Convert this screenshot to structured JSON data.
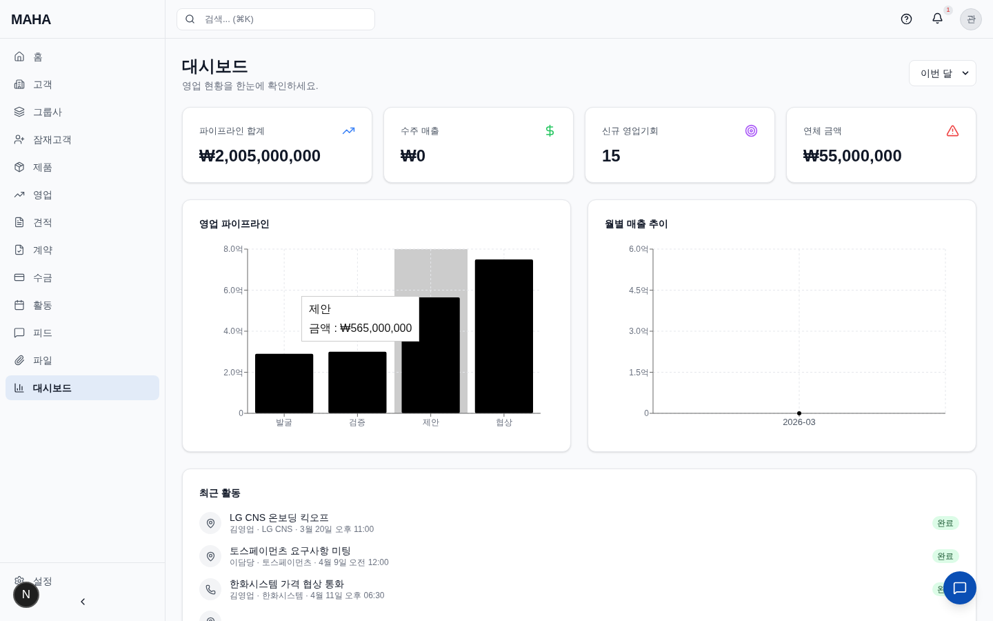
{
  "sidebar": {
    "logo": "MAHA",
    "items": [
      {
        "label": "홈",
        "selected": false
      },
      {
        "label": "고객",
        "selected": false
      },
      {
        "label": "그룹사",
        "selected": false
      },
      {
        "label": "잠재고객",
        "selected": false
      },
      {
        "label": "제품",
        "selected": false
      },
      {
        "label": "영업",
        "selected": false
      },
      {
        "label": "견적",
        "selected": false
      },
      {
        "label": "계약",
        "selected": false
      },
      {
        "label": "수금",
        "selected": false
      },
      {
        "label": "활동",
        "selected": false
      },
      {
        "label": "피드",
        "selected": false
      },
      {
        "label": "파일",
        "selected": false
      },
      {
        "label": "대시보드",
        "selected": true
      }
    ],
    "settings": "설정"
  },
  "dev_badge": "N",
  "header": {
    "search": {
      "placeholder": "검색... (⌘K)"
    },
    "notification_count": "1",
    "avatar": "관"
  },
  "page": {
    "title": "대시보드",
    "subtitle": "영업 현황을 한눈에 확인하세요.",
    "period": "이번 달"
  },
  "stats": [
    {
      "label": "파이프라인 합계",
      "value": "₩2,005,000,000",
      "kind": "trend",
      "color": "#3b82f6"
    },
    {
      "label": "수주 매출",
      "value": "₩0",
      "kind": "dollar",
      "color": "#22c55e"
    },
    {
      "label": "신규 영업기회",
      "value": "15",
      "kind": "target",
      "color": "#a855f7"
    },
    {
      "label": "연체 금액",
      "value": "₩55,000,000",
      "kind": "alert",
      "color": "#ef4444"
    }
  ],
  "pipeline": {
    "title": "영업 파이프라인",
    "highlight": [
      false,
      false,
      true,
      false
    ],
    "tooltip": {
      "title": "제안",
      "text": "금액 : ₩565,000,000"
    },
    "chart_data": {
      "type": "bar",
      "grid": true,
      "categories": [
        "발굴",
        "검증",
        "제안",
        "협상"
      ],
      "series": [
        {
          "color": "#000000",
          "values": [
            2.9,
            3.0,
            5.65,
            7.5
          ]
        }
      ],
      "ylim": [
        0,
        8
      ],
      "yticks": [
        {
          "value": 0,
          "label": "0"
        },
        {
          "value": 2,
          "label": "2.0억"
        },
        {
          "value": 4,
          "label": "4.0억"
        },
        {
          "value": 6,
          "label": "6.0억"
        },
        {
          "value": 8,
          "label": "8.0억"
        }
      ]
    }
  },
  "monthly": {
    "title": "월별 매출 추이",
    "chart_data": {
      "type": "line",
      "grid": true,
      "categories": [
        "2026-03"
      ],
      "series": [
        {
          "color": "#000000",
          "marker": true,
          "values": [
            0
          ]
        }
      ],
      "ylim": [
        0,
        6
      ],
      "yticks": [
        {
          "value": 0,
          "label": "0"
        },
        {
          "value": 1.5,
          "label": "1.5억"
        },
        {
          "value": 3,
          "label": "3.0억"
        },
        {
          "value": 4.5,
          "label": "4.5억"
        },
        {
          "value": 6,
          "label": "6.0억"
        }
      ]
    }
  },
  "activities": {
    "title": "최근 활동",
    "items": [
      {
        "kind": "visit",
        "title": "LG CNS 온보딩 킥오프",
        "meta": "김영업 · LG CNS · 3월 20일 오후 11:00",
        "status": "완료"
      },
      {
        "kind": "visit",
        "title": "토스페이먼츠 요구사항 미팅",
        "meta": "이담당 · 토스페이먼츠 · 4월 9일 오전 12:00",
        "status": "완료"
      },
      {
        "kind": "call",
        "title": "한화시스템 가격 협상 통화",
        "meta": "김영업 · 한화시스템 · 4월 11일 오후 06:30",
        "status": "완"
      },
      {
        "kind": "visit"
      }
    ]
  }
}
